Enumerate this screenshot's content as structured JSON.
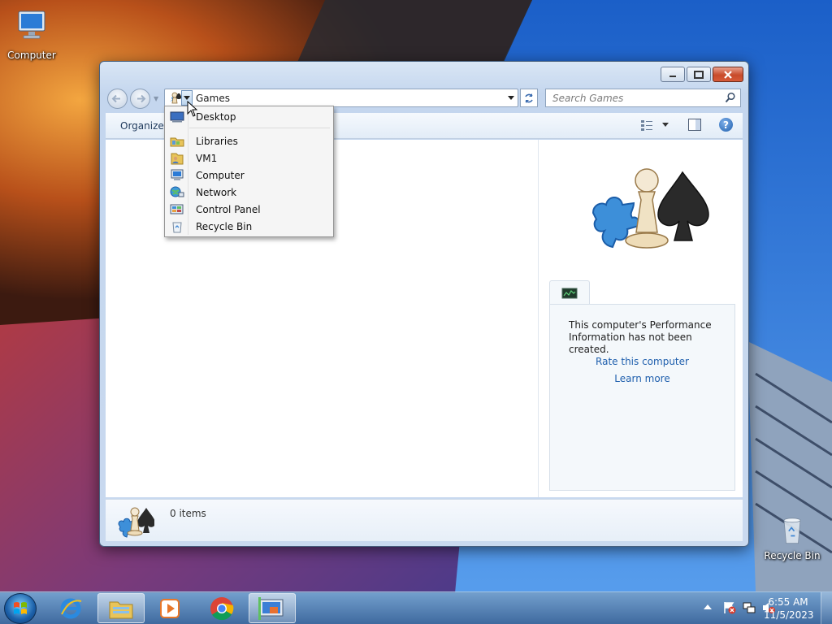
{
  "desktop": {
    "icons": [
      {
        "label": "Computer"
      },
      {
        "label": "Recycle Bin"
      }
    ]
  },
  "window": {
    "address": {
      "current": "Games",
      "dropdown_open": true
    },
    "search": {
      "placeholder": "Search Games"
    },
    "command_bar": {
      "organize_label": "Organize"
    },
    "breadcrumb_menu": {
      "items": [
        {
          "label": "Desktop",
          "icon": "desktop-icon"
        },
        {
          "label": "Libraries",
          "icon": "libraries-icon"
        },
        {
          "label": "VM1",
          "icon": "user-folder-icon"
        },
        {
          "label": "Computer",
          "icon": "computer-icon"
        },
        {
          "label": "Network",
          "icon": "network-icon"
        },
        {
          "label": "Control Panel",
          "icon": "control-panel-icon"
        },
        {
          "label": "Recycle Bin",
          "icon": "recycle-bin-icon"
        }
      ]
    },
    "preview": {
      "message": "This computer's Performance Information has not been created.",
      "links": [
        "Rate this computer",
        "Learn more"
      ]
    },
    "details": {
      "item_count": "0 items"
    }
  },
  "taskbar": {
    "pinned": [
      {
        "name": "internet-explorer-icon"
      },
      {
        "name": "windows-explorer-icon"
      },
      {
        "name": "media-player-icon"
      },
      {
        "name": "chrome-icon"
      },
      {
        "name": "games-explorer-icon"
      }
    ],
    "clock": {
      "time": "6:55 AM",
      "date": "11/5/2023"
    }
  },
  "colors": {
    "accent": "#1f5fad",
    "link": "#1f5fad",
    "close_button": "#c84b2b"
  }
}
